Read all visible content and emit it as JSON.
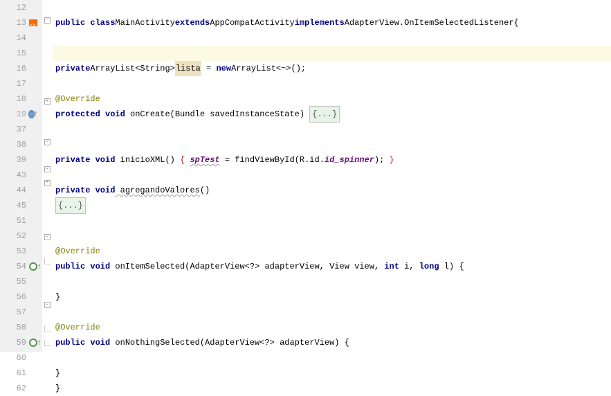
{
  "lines": {
    "l12": {
      "n": "12"
    },
    "l13": {
      "n": "13",
      "kw1": "public class",
      "name": "MainActivity",
      "kw2": "extends",
      "sup": "AppCompatActivity",
      "kw3": "implements",
      "iface": "AdapterView.OnItemSelectedListener",
      "brace": "{"
    },
    "l14": {
      "n": "14"
    },
    "l15": {
      "n": "15"
    },
    "l16": {
      "n": "16",
      "kw1": "private",
      "type": "ArrayList<String>",
      "name": "lista",
      "assign": " = ",
      "kw2": "new",
      "ctor": "ArrayList<~>",
      "call": "();"
    },
    "l17": {
      "n": "17"
    },
    "l18": {
      "n": "18",
      "ann": "@Override"
    },
    "l19": {
      "n": "19",
      "kw1": "protected void",
      "name": " onCreate",
      "params": "(Bundle savedInstanceState) ",
      "fold": "{...}"
    },
    "l37": {
      "n": "37"
    },
    "l38": {
      "n": "38"
    },
    "l39": {
      "n": "39",
      "kw1": "private void",
      "name": " inicioXML",
      "open": "() ",
      "brace1": "{ ",
      "field": "spTest",
      "rest": " = findViewById(R.id.",
      "id": "id_spinner",
      "close": "); ",
      "brace2": "}"
    },
    "l43": {
      "n": "43"
    },
    "l44": {
      "n": "44",
      "kw1": "private void",
      "name": " agregandoValores",
      "params": "()"
    },
    "l45": {
      "n": "45",
      "fold": "{...}"
    },
    "l51": {
      "n": "51"
    },
    "l52": {
      "n": "52"
    },
    "l53": {
      "n": "53",
      "ann": "@Override"
    },
    "l54": {
      "n": "54",
      "kw1": "public void",
      "name": " onItemSelected",
      "p1": "(AdapterView<?> adapterView, View view, ",
      "kw2": "int",
      "p2": " i, ",
      "kw3": "long",
      "p3": " l) {"
    },
    "l55": {
      "n": "55"
    },
    "l56": {
      "n": "56",
      "brace": "}"
    },
    "l57": {
      "n": "57"
    },
    "l58": {
      "n": "58",
      "ann": "@Override"
    },
    "l59": {
      "n": "59",
      "kw1": "public void",
      "name": " onNothingSelected",
      "params": "(AdapterView<?> adapterView) {"
    },
    "l60": {
      "n": "60"
    },
    "l61": {
      "n": "61",
      "brace": "}"
    },
    "l62": {
      "n": "62",
      "brace": "}"
    }
  },
  "fold": {
    "minus": "−",
    "plus": "+"
  }
}
